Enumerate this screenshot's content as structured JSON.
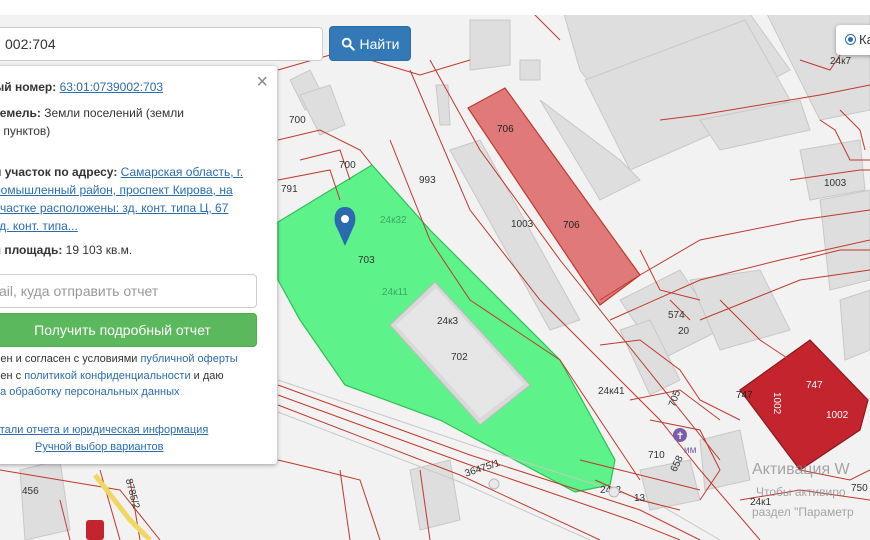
{
  "search": {
    "value": "002:704",
    "button_label": "Найти"
  },
  "layer_control": {
    "label": "Ка"
  },
  "panel": {
    "cadastral_label": "ый номер:",
    "cadastral_number": "63:01:0739002:703",
    "land_category_label": "земель:",
    "land_category_value_1": "Земли поселений (земли",
    "land_category_value_2": "х пунктов)",
    "address_label": "й участок по адресу:",
    "address_line_1": "Самарская область, г.",
    "address_line_2": "ромышленный район, проспект Кирова, на",
    "address_line_3": "участке расположены: зд. конт. типа Ц, 67",
    "address_line_4": "зд. конт. типа...",
    "area_label": "я площадь:",
    "area_value": "19 103 кв.м.",
    "email_placeholder": "ail, куда отправить отчет",
    "report_button": "Получить подробный отчет",
    "agree_1_prefix": "лен и согласен с условиями ",
    "agree_1_link": "публичной оферты",
    "agree_2_prefix": "лен с ",
    "agree_2_link": "политикой конфиденциальности",
    "agree_2_suffix": " и даю",
    "agree_3_link": "на обработку персональных данных",
    "details_link": "етали отчета и юридическая информация",
    "manual_link": "Ручной выбор вариантов"
  },
  "map_labels": {
    "l_24k7": "24к7",
    "l_700a": "700",
    "l_700b": "700",
    "l_791": "791",
    "l_993": "993",
    "l_706a": "706",
    "l_706b": "706",
    "l_1003a": "1003",
    "l_1003b": "1003",
    "l_24k32": "24к32",
    "l_703": "703",
    "l_24k11": "24к11",
    "l_24k3": "24к3",
    "l_702": "702",
    "l_574": "574",
    "l_20": "20",
    "l_24k41": "24к41",
    "l_705": "705",
    "l_747a": "747",
    "l_747b": "747",
    "l_1002a": "1002",
    "l_1002b": "1002",
    "l_710": "710",
    "l_658": "658",
    "l_36475": "36475/1",
    "l_24k2": "24к2",
    "l_13": "13",
    "l_24k1": "24к1",
    "l_750": "750",
    "l_456": "456",
    "l_8785": "8785/2",
    "l_im": "им"
  },
  "watermark": {
    "line1": "Активация W",
    "line2": "Чтобы активиро",
    "line3": "раздел \"Параметр"
  },
  "colors": {
    "selected_parcel": "#5ef28a",
    "highlight_pink": "#e07a7a",
    "highlight_red": "#c3242e",
    "boundary": "#c0392b",
    "building": "#dcdcdc",
    "search_button": "#3379b7",
    "report_button": "#5cb85c"
  }
}
